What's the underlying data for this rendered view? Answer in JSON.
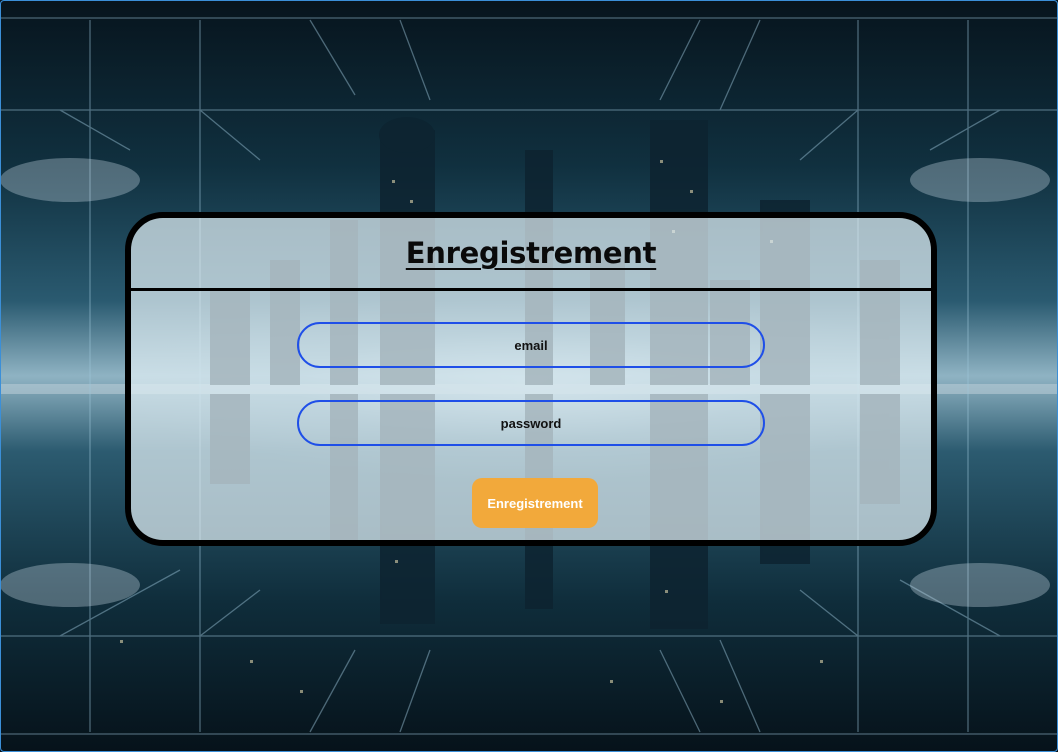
{
  "form": {
    "title": "Enregistrement",
    "email_placeholder": "email",
    "password_placeholder": "password",
    "submit_label": "Enregistrement"
  },
  "colors": {
    "field_border": "#1f4fe8",
    "button_bg": "#f2a93b",
    "card_border": "#000000"
  }
}
